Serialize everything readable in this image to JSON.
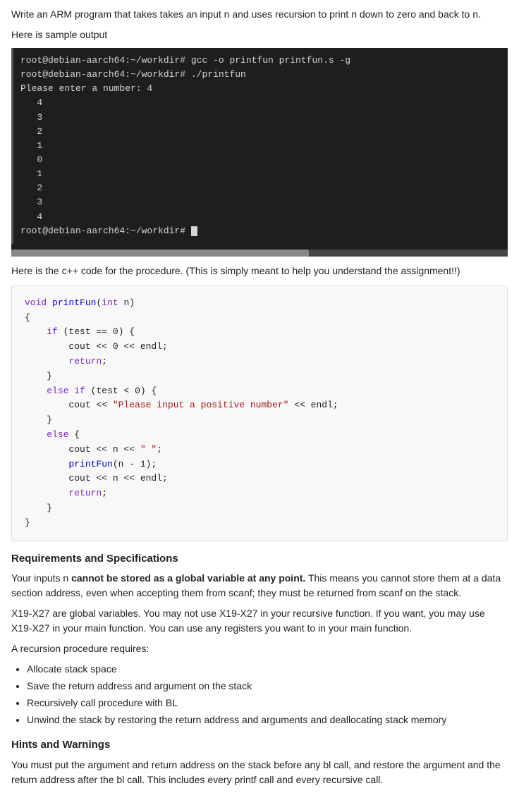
{
  "assignment": {
    "description": "Write an ARM program that takes takes an input n and uses recursion to print n down to zero and back to n.",
    "sample_label": "Here is sample output",
    "cpp_label": "Here is the c++ code for the procedure.  (This is simply meant to help you understand the assignment!!)"
  },
  "terminal": {
    "lines": [
      "root@debian-aarch64:~/workdir# gcc -o printfun printfun.s -g",
      "root@debian-aarch64:~/workdir# ./printfun",
      "Please enter a number: 4",
      "   4",
      "   3",
      "   2",
      "   1",
      "   0",
      "   1",
      "   2",
      "   3",
      "   4",
      "root@debian-aarch64:~/workdir# "
    ]
  },
  "code": {
    "lines": [
      {
        "type": "kw",
        "text": "void"
      },
      {
        "type": "fn",
        "text": " printFun"
      },
      {
        "type": "plain",
        "text": "("
      },
      {
        "type": "kw",
        "text": "int"
      },
      {
        "type": "plain",
        "text": " n)"
      }
    ],
    "raw": "void printFun(int n)\n{\n    if (test == 0) {\n        cout << 0 << endl;\n        return;\n    }\n    else if (test < 0) {\n        cout << \"Please input a positive number\" << endl;\n    }\n    else {\n        cout << n << \" \";\n        printFun(n - 1);\n        cout << n << endl;\n        return;\n    }\n}"
  },
  "requirements": {
    "title": "Requirements and Specifications",
    "para1_start": "Your inputs n ",
    "para1_bold": "cannot be stored as a global variable at any point.",
    "para1_end": " This means you cannot store them at a data section address, even when accepting them from scanf; they must be returned from scanf on the stack.",
    "para2": "X19-X27 are global variables. You may not use X19-X27 in your recursive function. If you want, you may use X19-X27 in your main function.  You can use any registers you want to in your main function.",
    "para3": "A recursion procedure requires:",
    "bullets": [
      "Allocate stack space",
      "Save the return address and argument on the stack",
      "Recursively call procedure with BL",
      "Unwind the stack by restoring the return address and arguments and deallocating stack memory"
    ]
  },
  "hints": {
    "title": "Hints and Warnings",
    "para1": "You must put the argument and return address on the stack before any bl call, and restore the argument and the return address after the bl call.   This includes every printf call and every recursive call."
  }
}
